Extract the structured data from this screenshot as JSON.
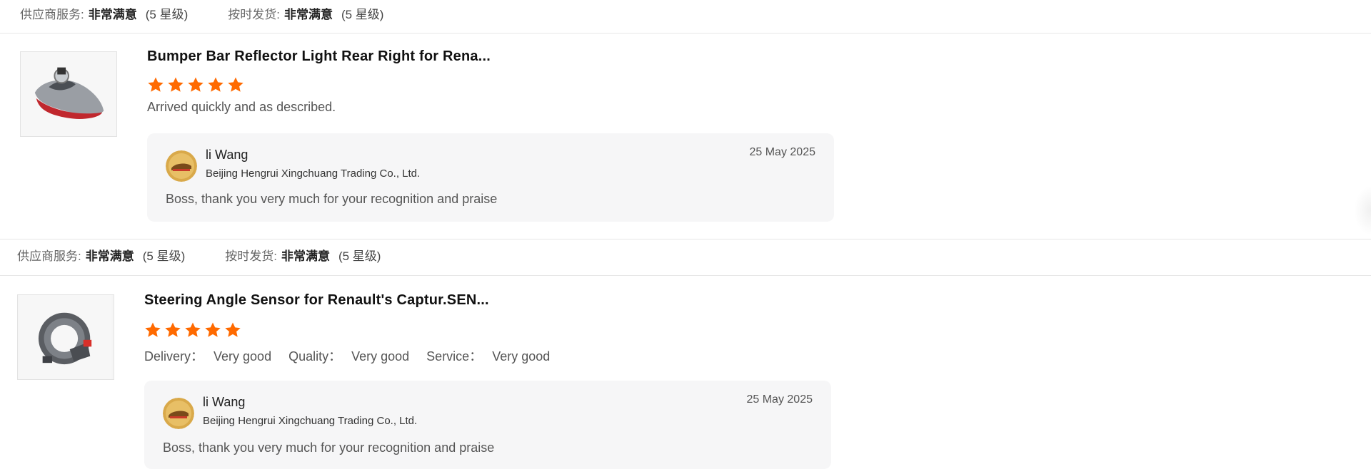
{
  "reviews": [
    {
      "supplier_rating": {
        "service_label": "供应商服务:",
        "service_value": "非常满意",
        "service_level": "(5 星级)",
        "shipping_label": "按时发货:",
        "shipping_value": "非常满意",
        "shipping_level": "(5 星级)"
      },
      "product_title": "Bumper Bar Reflector Light Rear Right for Rena...",
      "product_image_icon": "tail-light-image",
      "stars": 5,
      "review_text": "Arrived quickly and as described.",
      "reply": {
        "avatar_icon": "company-logo-avatar",
        "name": "li Wang",
        "company": "Beijing Hengrui Xingchuang Trading Co., Ltd.",
        "date": "25 May 2025",
        "text": "Boss, thank you very much for your recognition and praise"
      }
    },
    {
      "supplier_rating": {
        "service_label": "供应商服务:",
        "service_value": "非常满意",
        "service_level": "(5 星级)",
        "shipping_label": "按时发货:",
        "shipping_value": "非常满意",
        "shipping_level": "(5 星级)"
      },
      "product_title": "Steering Angle Sensor for Renault's Captur.SEN...",
      "product_image_icon": "steering-sensor-image",
      "stars": 5,
      "review_details": [
        {
          "label": "Delivery：",
          "value": "Very good"
        },
        {
          "label": "Quality：",
          "value": "Very good"
        },
        {
          "label": "Service：",
          "value": "Very good"
        }
      ],
      "reply": {
        "avatar_icon": "company-logo-avatar",
        "name": "li Wang",
        "company": "Beijing Hengrui Xingchuang Trading Co., Ltd.",
        "date": "25 May 2025",
        "text": "Boss, thank you very much for your recognition and praise"
      }
    }
  ],
  "colors": {
    "star": "#ff6a00",
    "reply_bg": "#f6f6f7",
    "divider": "#e6e6e6"
  }
}
